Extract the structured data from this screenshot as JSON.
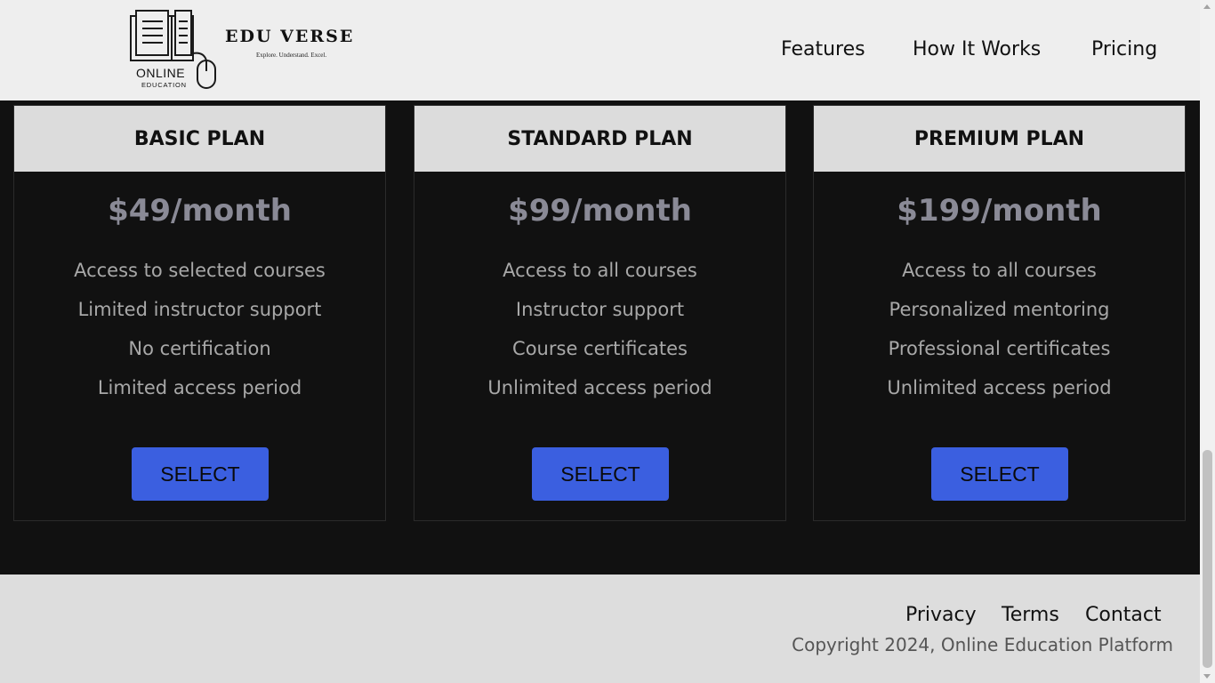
{
  "header": {
    "brand": "EDU VERSE",
    "tagline": "Explore. Understand. Excel.",
    "logo_text_1": "ONLINE",
    "logo_text_2": "EDUCATION",
    "nav": [
      "Features",
      "How It Works",
      "Pricing"
    ]
  },
  "plans": [
    {
      "title": "BASIC PLAN",
      "price": "$49/month",
      "features": [
        "Access to selected courses",
        "Limited instructor support",
        "No certification",
        "Limited access period"
      ],
      "button": "SELECT"
    },
    {
      "title": "STANDARD PLAN",
      "price": "$99/month",
      "features": [
        "Access to all courses",
        "Instructor support",
        "Course certificates",
        "Unlimited access period"
      ],
      "button": "SELECT"
    },
    {
      "title": "PREMIUM PLAN",
      "price": "$199/month",
      "features": [
        "Access to all courses",
        "Personalized mentoring",
        "Professional certificates",
        "Unlimited access period"
      ],
      "button": "SELECT"
    }
  ],
  "footer": {
    "links": [
      "Privacy",
      "Terms",
      "Contact"
    ],
    "copyright": "Copyright 2024, Online Education Platform"
  },
  "colors": {
    "accent": "#3b5fe0",
    "header_bg": "#eeeeee",
    "page_bg": "#111111",
    "footer_bg": "#dddddd"
  }
}
